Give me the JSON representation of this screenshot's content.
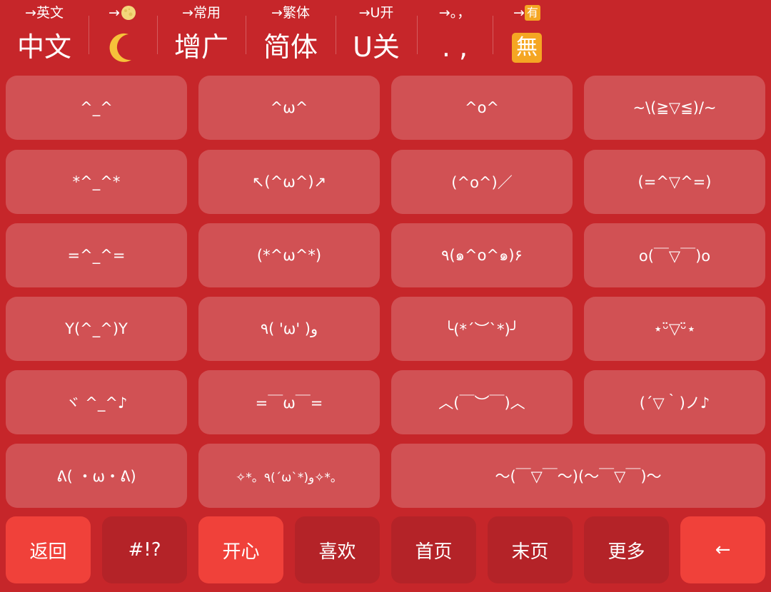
{
  "toolbar": {
    "items": [
      {
        "hint": "→英文",
        "main": "中文"
      },
      {
        "hint": "→",
        "main": ""
      },
      {
        "hint": "→常用",
        "main": "增广"
      },
      {
        "hint": "→繁体",
        "main": "简体"
      },
      {
        "hint": "→U开",
        "main": "U关"
      },
      {
        "hint": "→。，",
        "main": ". ,"
      },
      {
        "hint": "→",
        "hint_badge": "有",
        "main_badge": "無"
      }
    ]
  },
  "kaomoji": [
    "^_^",
    "^ω^",
    "^o^",
    "~\\(≧▽≦)/~",
    "*^_^*",
    "↖(^ω^)↗",
    "(^o^)／",
    "(=^▽^=)",
    "=^_^=",
    "(*^ω^*)",
    "٩(๑^o^๑)۶",
    "o(￣▽￣)o",
    "Y(^_^)Y",
    "٩( 'ω' )و",
    "╰(*´︶`*)╯",
    "⋆ᵕ̈▽ᵕ̈⋆",
    "ヾ ^_^♪",
    "=￣ω￣=",
    "︿(￣︶￣)︿",
    "(´▽｀)ノ♪",
    "ᕕ( ・ω・ᕕ)",
    "✧*。٩(ˊωˋ*)و✧*。",
    "～(￣▽￣～)(～￣▽￣)～"
  ],
  "bottom": {
    "back": "返回",
    "symbols": "#!?",
    "happy": "开心",
    "like": "喜欢",
    "first_page": "首页",
    "last_page": "末页",
    "more": "更多",
    "backspace": "←"
  },
  "colors": {
    "background": "#c6262a",
    "key_tint": "rgba(255,255,255,0.2)",
    "accent": "#f0413a",
    "dark_key": "#b42328",
    "badge": "#f5a623"
  }
}
